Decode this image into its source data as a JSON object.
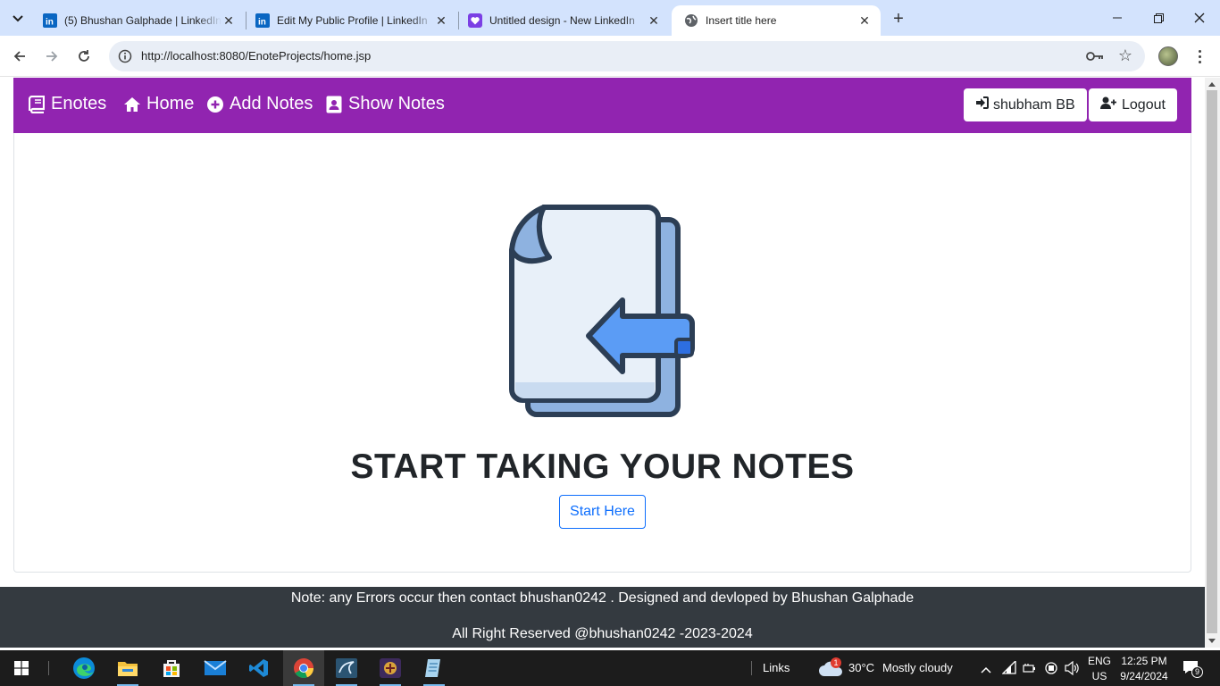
{
  "browser": {
    "tabs": [
      {
        "title": "(5) Bhushan Galphade | LinkedIn",
        "favicon": "linkedin-icon",
        "active": false
      },
      {
        "title": "Edit My Public Profile | LinkedIn",
        "favicon": "linkedin-icon",
        "active": false
      },
      {
        "title": "Untitled design - New LinkedIn",
        "favicon": "canva-heart-icon",
        "active": false
      },
      {
        "title": "Insert title here",
        "favicon": "globe-icon",
        "active": true
      }
    ],
    "url": "http://localhost:8080/EnoteProjects/home.jsp"
  },
  "app_nav": {
    "brand": "Enotes",
    "links": [
      "Home",
      "Add Notes",
      "Show Notes"
    ],
    "user_button": "shubham BB",
    "logout_button": "Logout",
    "color": "#9124b0"
  },
  "hero": {
    "title": "START TAKING YOUR NOTES",
    "button": "Start Here"
  },
  "footer": {
    "line1": "Note: any Errors occur then contact bhushan0242 . Designed and devloped by Bhushan Galphade",
    "line2": "All Right Reserved @bhushan0242 -2023-2024"
  },
  "taskbar": {
    "links_label": "Links",
    "weather_badge": "1",
    "weather_temp": "30°C",
    "weather_desc": "Mostly cloudy",
    "lang": "ENG",
    "region": "US",
    "time": "12:25 PM",
    "date": "9/24/2024",
    "notifications": "9"
  }
}
